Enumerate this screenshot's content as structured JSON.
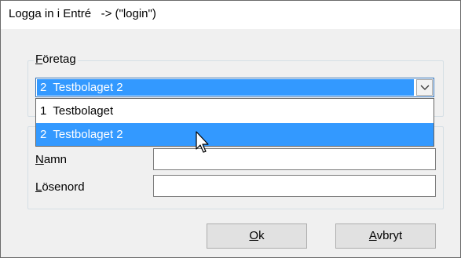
{
  "window": {
    "title": "Logga in i Entré   -> (\"login\")"
  },
  "company_group": {
    "legend_first": "F",
    "legend_rest": "öretag",
    "selected_value": "2  Testbolaget 2",
    "options": [
      "1  Testbolaget",
      "2  Testbolaget 2"
    ]
  },
  "credentials": {
    "name_first": "N",
    "name_rest": "amn",
    "password_first": "L",
    "password_rest": "ösenord",
    "name_value": "",
    "password_value": ""
  },
  "buttons": {
    "ok_first": "O",
    "ok_rest": "k",
    "cancel_first": "A",
    "cancel_rest": "vbryt"
  },
  "colors": {
    "selection": "#3399ff",
    "window_bg": "#f0f0f0"
  },
  "icons": {
    "dropdown": "chevron-down-icon",
    "cursor": "mouse-pointer-icon"
  }
}
